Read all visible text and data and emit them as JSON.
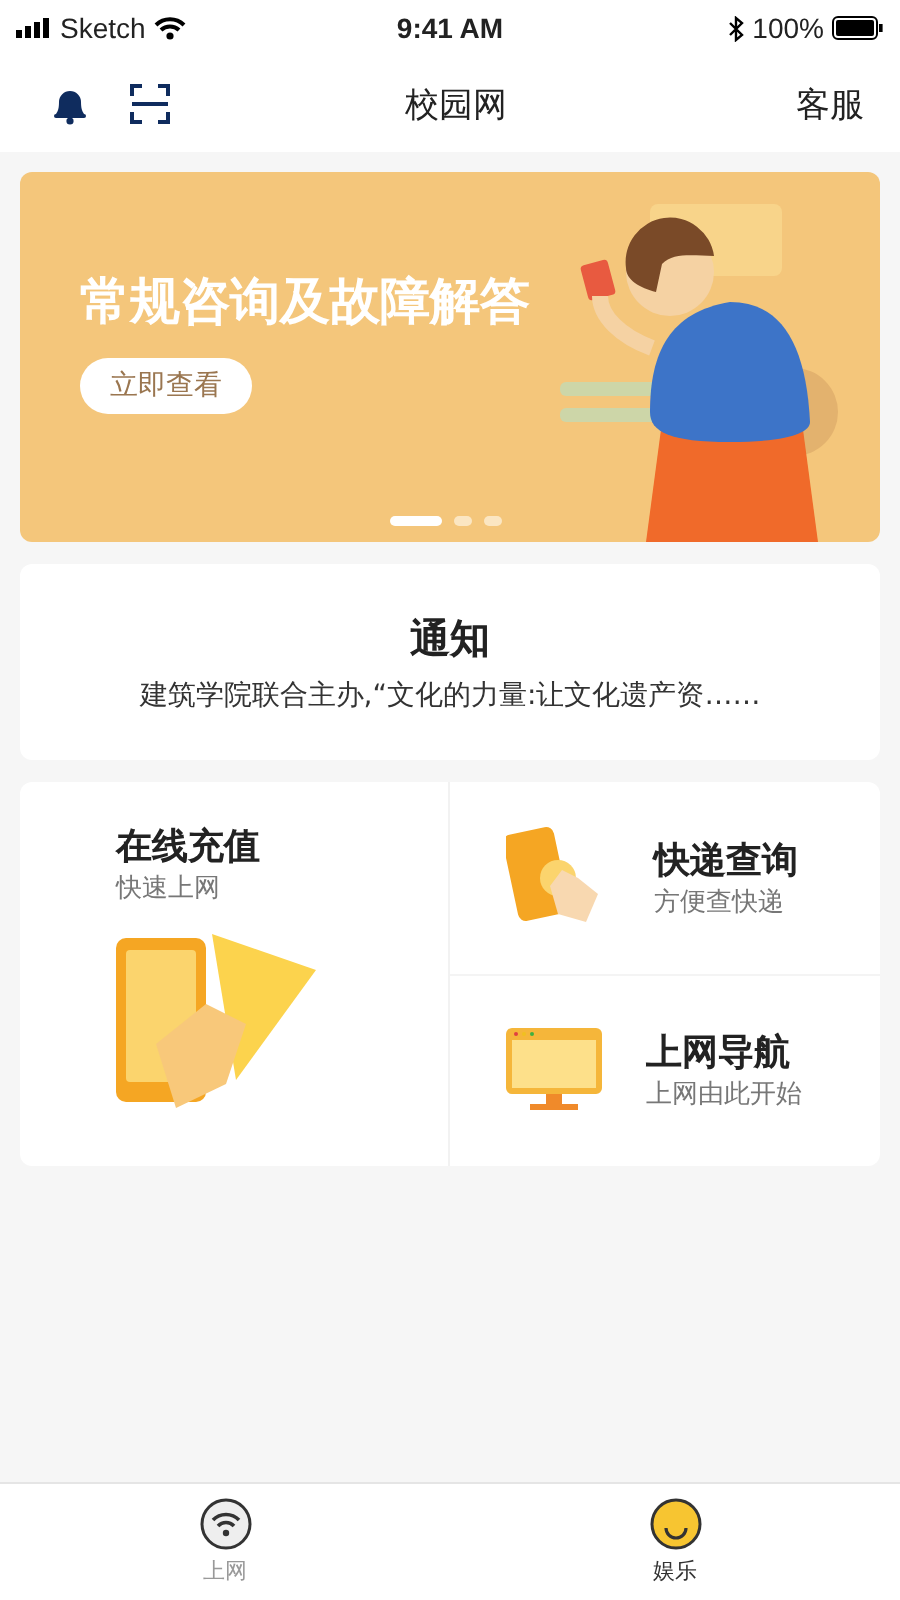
{
  "status_bar": {
    "carrier": "Sketch",
    "time": "9:41 AM",
    "battery": "100%"
  },
  "nav": {
    "title": "校园网",
    "right": "客服"
  },
  "banner": {
    "title": "常规咨询及故障解答",
    "button": "立即查看",
    "dots": [
      {
        "selected": true
      },
      {
        "selected": false
      },
      {
        "selected": false
      }
    ]
  },
  "notice": {
    "title": "通知",
    "text": "建筑学院联合主办,“文化的力量:让文化遗产资……"
  },
  "services": [
    {
      "kind": "recharge",
      "title": "在线充值",
      "subtitle": "快速上网"
    },
    {
      "kind": "express",
      "title": "快递查询",
      "subtitle": "方便查快递"
    },
    {
      "kind": "navigation",
      "title": "上网导航",
      "subtitle": "上网由此开始"
    }
  ],
  "tab_bar": [
    {
      "kind": "wifi",
      "label": "上网",
      "selected": false
    },
    {
      "kind": "fun",
      "label": "娱乐",
      "selected": true
    }
  ]
}
